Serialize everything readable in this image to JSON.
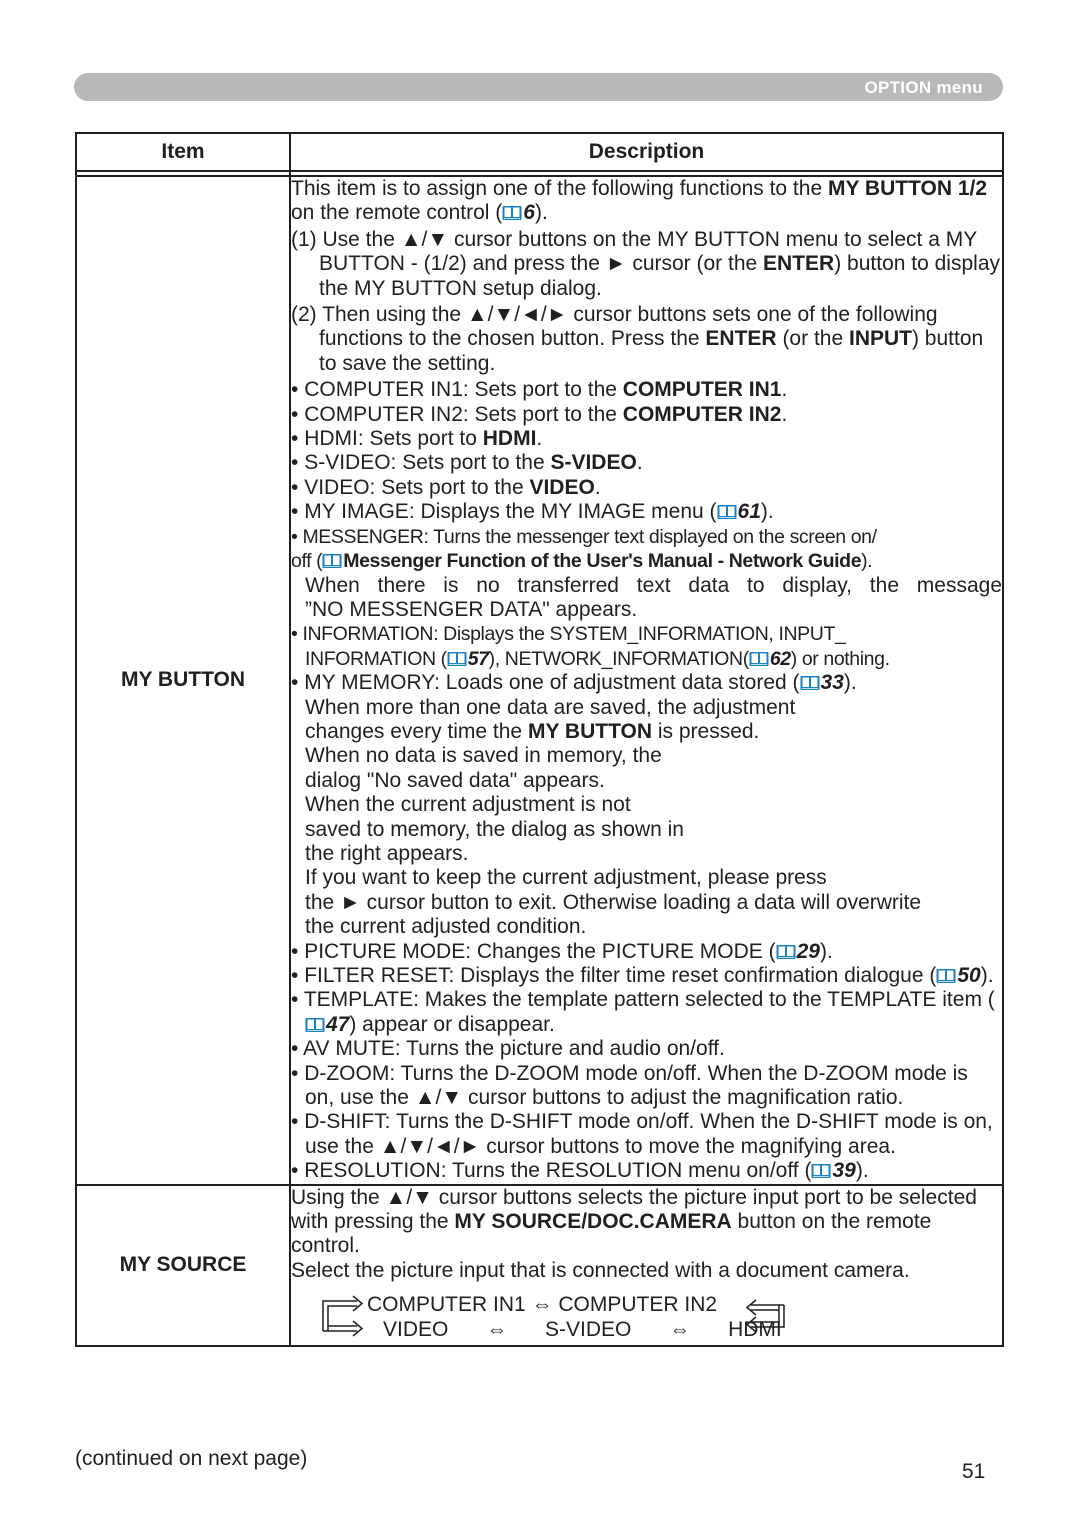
{
  "header": {
    "section_title": "OPTION menu"
  },
  "table": {
    "columns": [
      "Item",
      "Description"
    ],
    "rows": [
      {
        "item": "MY BUTTON",
        "intro": {
          "t1": "This item is to assign one of the following functions to the ",
          "b1": "MY BUTTON 1/2",
          "t2": " on the remote control (",
          "ref": "6",
          "t3": ")."
        },
        "steps": [
          {
            "n": "(1)",
            "t1": " Use the ▲/▼ cursor buttons on the MY BUTTON menu to select a MY BUTTON - (1/2) and press the ► cursor (or the ",
            "b1": "ENTER",
            "t2": ") button to display the MY BUTTON setup dialog."
          },
          {
            "n": "(2)",
            "t1": " Then using the ▲/▼/◄/► cursor buttons sets one of the following functions to the chosen button. Press the ",
            "b1": "ENTER",
            "t2": " (or the ",
            "b2": "INPUT",
            "t3": ") button to save the setting."
          }
        ],
        "bullets": {
          "computer_in1": {
            "t1": "COMPUTER IN1: Sets port to the ",
            "b1": "COMPUTER IN1",
            "t2": "."
          },
          "computer_in2": {
            "t1": "COMPUTER IN2: Sets port to the ",
            "b1": "COMPUTER IN2",
            "t2": "."
          },
          "hdmi": {
            "t1": "HDMI: Sets port to ",
            "b1": "HDMI",
            "t2": "."
          },
          "svideo": {
            "t1": "S-VIDEO: Sets port to the ",
            "b1": "S-VIDEO",
            "t2": "."
          },
          "video": {
            "t1": "VIDEO: Sets port to the ",
            "b1": "VIDEO",
            "t2": "."
          },
          "my_image": {
            "t1": "MY IMAGE: Displays the MY IMAGE menu (",
            "ref": "61",
            "t2": ")."
          },
          "messenger": {
            "t1": "MESSENGER: Turns the messenger text displayed on the screen on/",
            "t2": "off (",
            "b1": "Messenger Function of the User's Manual - Network Guide",
            "t3": ").",
            "t4": "When there is no transferred text data to display, the message",
            "t5": "”NO MESSENGER DATA\" appears."
          },
          "information": {
            "t1": "INFORMATION: Displays the SYSTEM_INFORMATION, INPUT_",
            "t2": "INFORMATION (",
            "ref1": "57",
            "t3": "), NETWORK_INFORMATION(",
            "ref2": "62",
            "t4": ") or nothing."
          },
          "my_memory": {
            "t1": "MY MEMORY: Loads one of adjustment data stored (",
            "ref": "33",
            "t2": ").",
            "lines": [
              "When more than one data are saved, the adjustment"
            ],
            "l2a": "changes every time the ",
            "l2b": "MY BUTTON",
            "l2c": " is pressed.",
            "more": [
              "When no data is saved in memory, the",
              "dialog \"No saved data\" appears.",
              "When the current adjustment is not",
              "saved to memory, the dialog as shown in",
              "the right appears.",
              "If you want to keep the current adjustment, please press",
              "the ► cursor button to exit. Otherwise loading a data will overwrite",
              "the current adjusted condition."
            ]
          },
          "picture_mode": {
            "t1": "PICTURE MODE: Changes the PICTURE MODE (",
            "ref": "29",
            "t2": ")."
          },
          "filter_reset": {
            "t1": "FILTER RESET: Displays the filter time reset confirmation dialogue (",
            "ref": "50",
            "t2": ")."
          },
          "template": {
            "t1": "TEMPLATE: Makes the template pattern selected to the TEMPLATE item (",
            "ref": "47",
            "t2": ") appear or disappear."
          },
          "av_mute": {
            "t1": "AV MUTE: Turns the picture and audio on/off."
          },
          "d_zoom": {
            "t1": "D-ZOOM: Turns the D-ZOOM mode on/off. When the D-ZOOM mode is on, use the ▲/▼ cursor buttons to adjust the magnification ratio."
          },
          "d_shift": {
            "t1": "D-SHIFT: Turns the D-SHIFT mode on/off. When the D-SHIFT mode is on, use the ▲/▼/◄/► cursor buttons to move the magnifying area."
          },
          "resolution": {
            "t1": "RESOLUTION: Turns the RESOLUTION menu on/off (",
            "ref": "39",
            "t2": ")."
          }
        }
      },
      {
        "item": "MY SOURCE",
        "p1": {
          "t1": "Using the ▲/▼ cursor buttons selects the picture input port to be selected with pressing the ",
          "b1": "MY SOURCE/DOC.CAMERA",
          "t2": " button on the remote control."
        },
        "p2": "Select the picture input that is connected with a document camera.",
        "cycle": {
          "row1": [
            "COMPUTER IN1",
            "COMPUTER IN2"
          ],
          "row2": [
            "VIDEO",
            "S-VIDEO",
            "HDMI"
          ],
          "arrow": "⇔"
        }
      }
    ]
  },
  "footer": {
    "note": "(continued on next page)",
    "page_number": "51"
  },
  "colors": {
    "header_bar": "#b8b8b9",
    "book_icon": "#1a80c4",
    "text": "#231f20"
  }
}
